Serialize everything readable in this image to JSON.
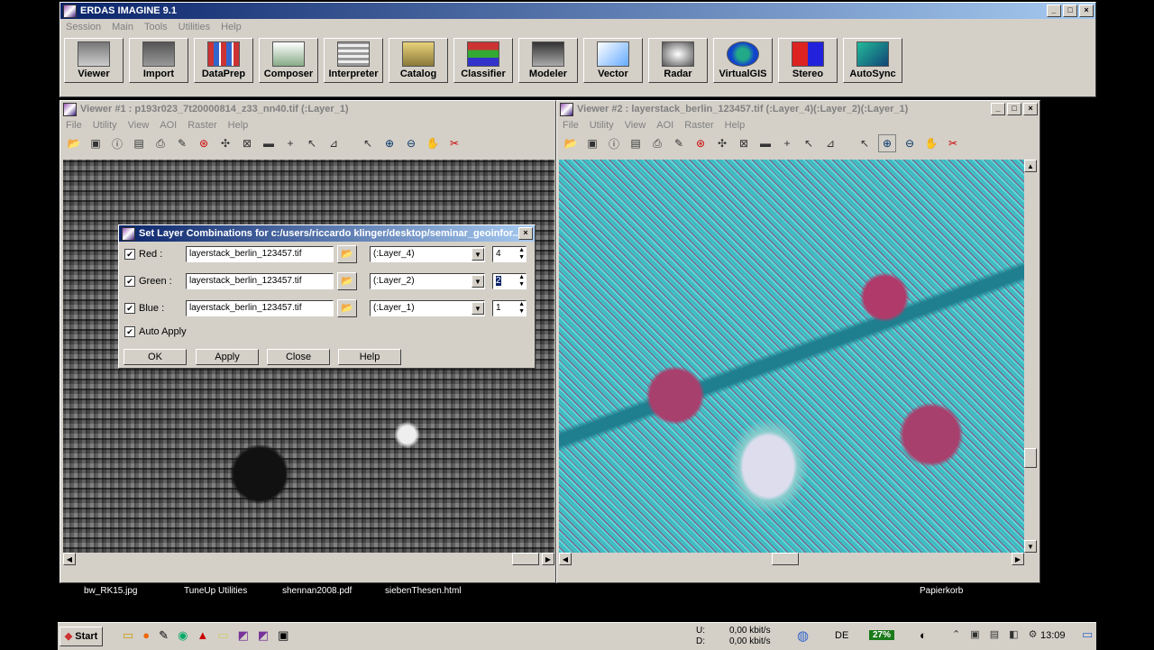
{
  "app": {
    "title": "ERDAS IMAGINE 9.1",
    "menu": [
      "Session",
      "Main",
      "Tools",
      "Utilities",
      "Help"
    ],
    "tools": [
      {
        "label": "Viewer",
        "icon": "viewer-icon"
      },
      {
        "label": "Import",
        "icon": "import-icon"
      },
      {
        "label": "DataPrep",
        "icon": "dataprep-icon"
      },
      {
        "label": "Composer",
        "icon": "composer-icon"
      },
      {
        "label": "Interpreter",
        "icon": "interpreter-icon"
      },
      {
        "label": "Catalog",
        "icon": "catalog-icon"
      },
      {
        "label": "Classifier",
        "icon": "classifier-icon"
      },
      {
        "label": "Modeler",
        "icon": "modeler-icon"
      },
      {
        "label": "Vector",
        "icon": "vector-icon"
      },
      {
        "label": "Radar",
        "icon": "radar-icon"
      },
      {
        "label": "VirtualGIS",
        "icon": "globe-icon"
      },
      {
        "label": "Stereo",
        "icon": "stereo-icon"
      },
      {
        "label": "AutoSync",
        "icon": "autosync-icon"
      }
    ]
  },
  "viewer1": {
    "title": "Viewer #1 : p193r023_7t20000814_z33_nn40.tif (:Layer_1)",
    "menu": [
      "File",
      "Utility",
      "View",
      "AOI",
      "Raster",
      "Help"
    ]
  },
  "viewer2": {
    "title": "Viewer #2 : layerstack_berlin_123457.tif (:Layer_4)(:Layer_2)(:Layer_1)",
    "menu": [
      "File",
      "Utility",
      "View",
      "AOI",
      "Raster",
      "Help"
    ]
  },
  "viewer_toolbar": [
    "open-icon",
    "new-icon",
    "info-icon",
    "save-icon",
    "print-icon",
    "eraser-icon",
    "target-icon",
    "fit-icon",
    "scale-icon",
    "measure-icon",
    "crosshair-icon",
    "inquire-icon",
    "profile-icon",
    "pointer-icon",
    "zoom-in-icon",
    "zoom-out-icon",
    "pan-icon",
    "link-icon"
  ],
  "dialog": {
    "title": "Set Layer Combinations for c:/users/riccardo klinger/desktop/seminar_geoinfor...",
    "rows": [
      {
        "label": "Red :",
        "checked": "✔",
        "file": "layerstack_berlin_123457.tif",
        "layer": "(:Layer_4)",
        "number": "4"
      },
      {
        "label": "Green :",
        "checked": "✔",
        "file": "layerstack_berlin_123457.tif",
        "layer": "(:Layer_2)",
        "number": "2"
      },
      {
        "label": "Blue :",
        "checked": "✔",
        "file": "layerstack_berlin_123457.tif",
        "layer": "(:Layer_1)",
        "number": "1"
      }
    ],
    "auto_apply_label": "Auto Apply",
    "auto_apply_checked": "✔",
    "buttons": {
      "ok": "OK",
      "apply": "Apply",
      "close": "Close",
      "help": "Help"
    }
  },
  "desktop_icons": [
    "bw_RK15.jpg",
    "TuneUp Utilities",
    "shennan2008.pdf",
    "siebenThesen.html",
    "Papierkorb"
  ],
  "taskbar": {
    "start": "Start",
    "net_up_label": "U:",
    "net_down_label": "D:",
    "net_up": "0,00 kbit/s",
    "net_down": "0,00 kbit/s",
    "lang": "DE",
    "battery": "27%",
    "clock": "13:09"
  }
}
